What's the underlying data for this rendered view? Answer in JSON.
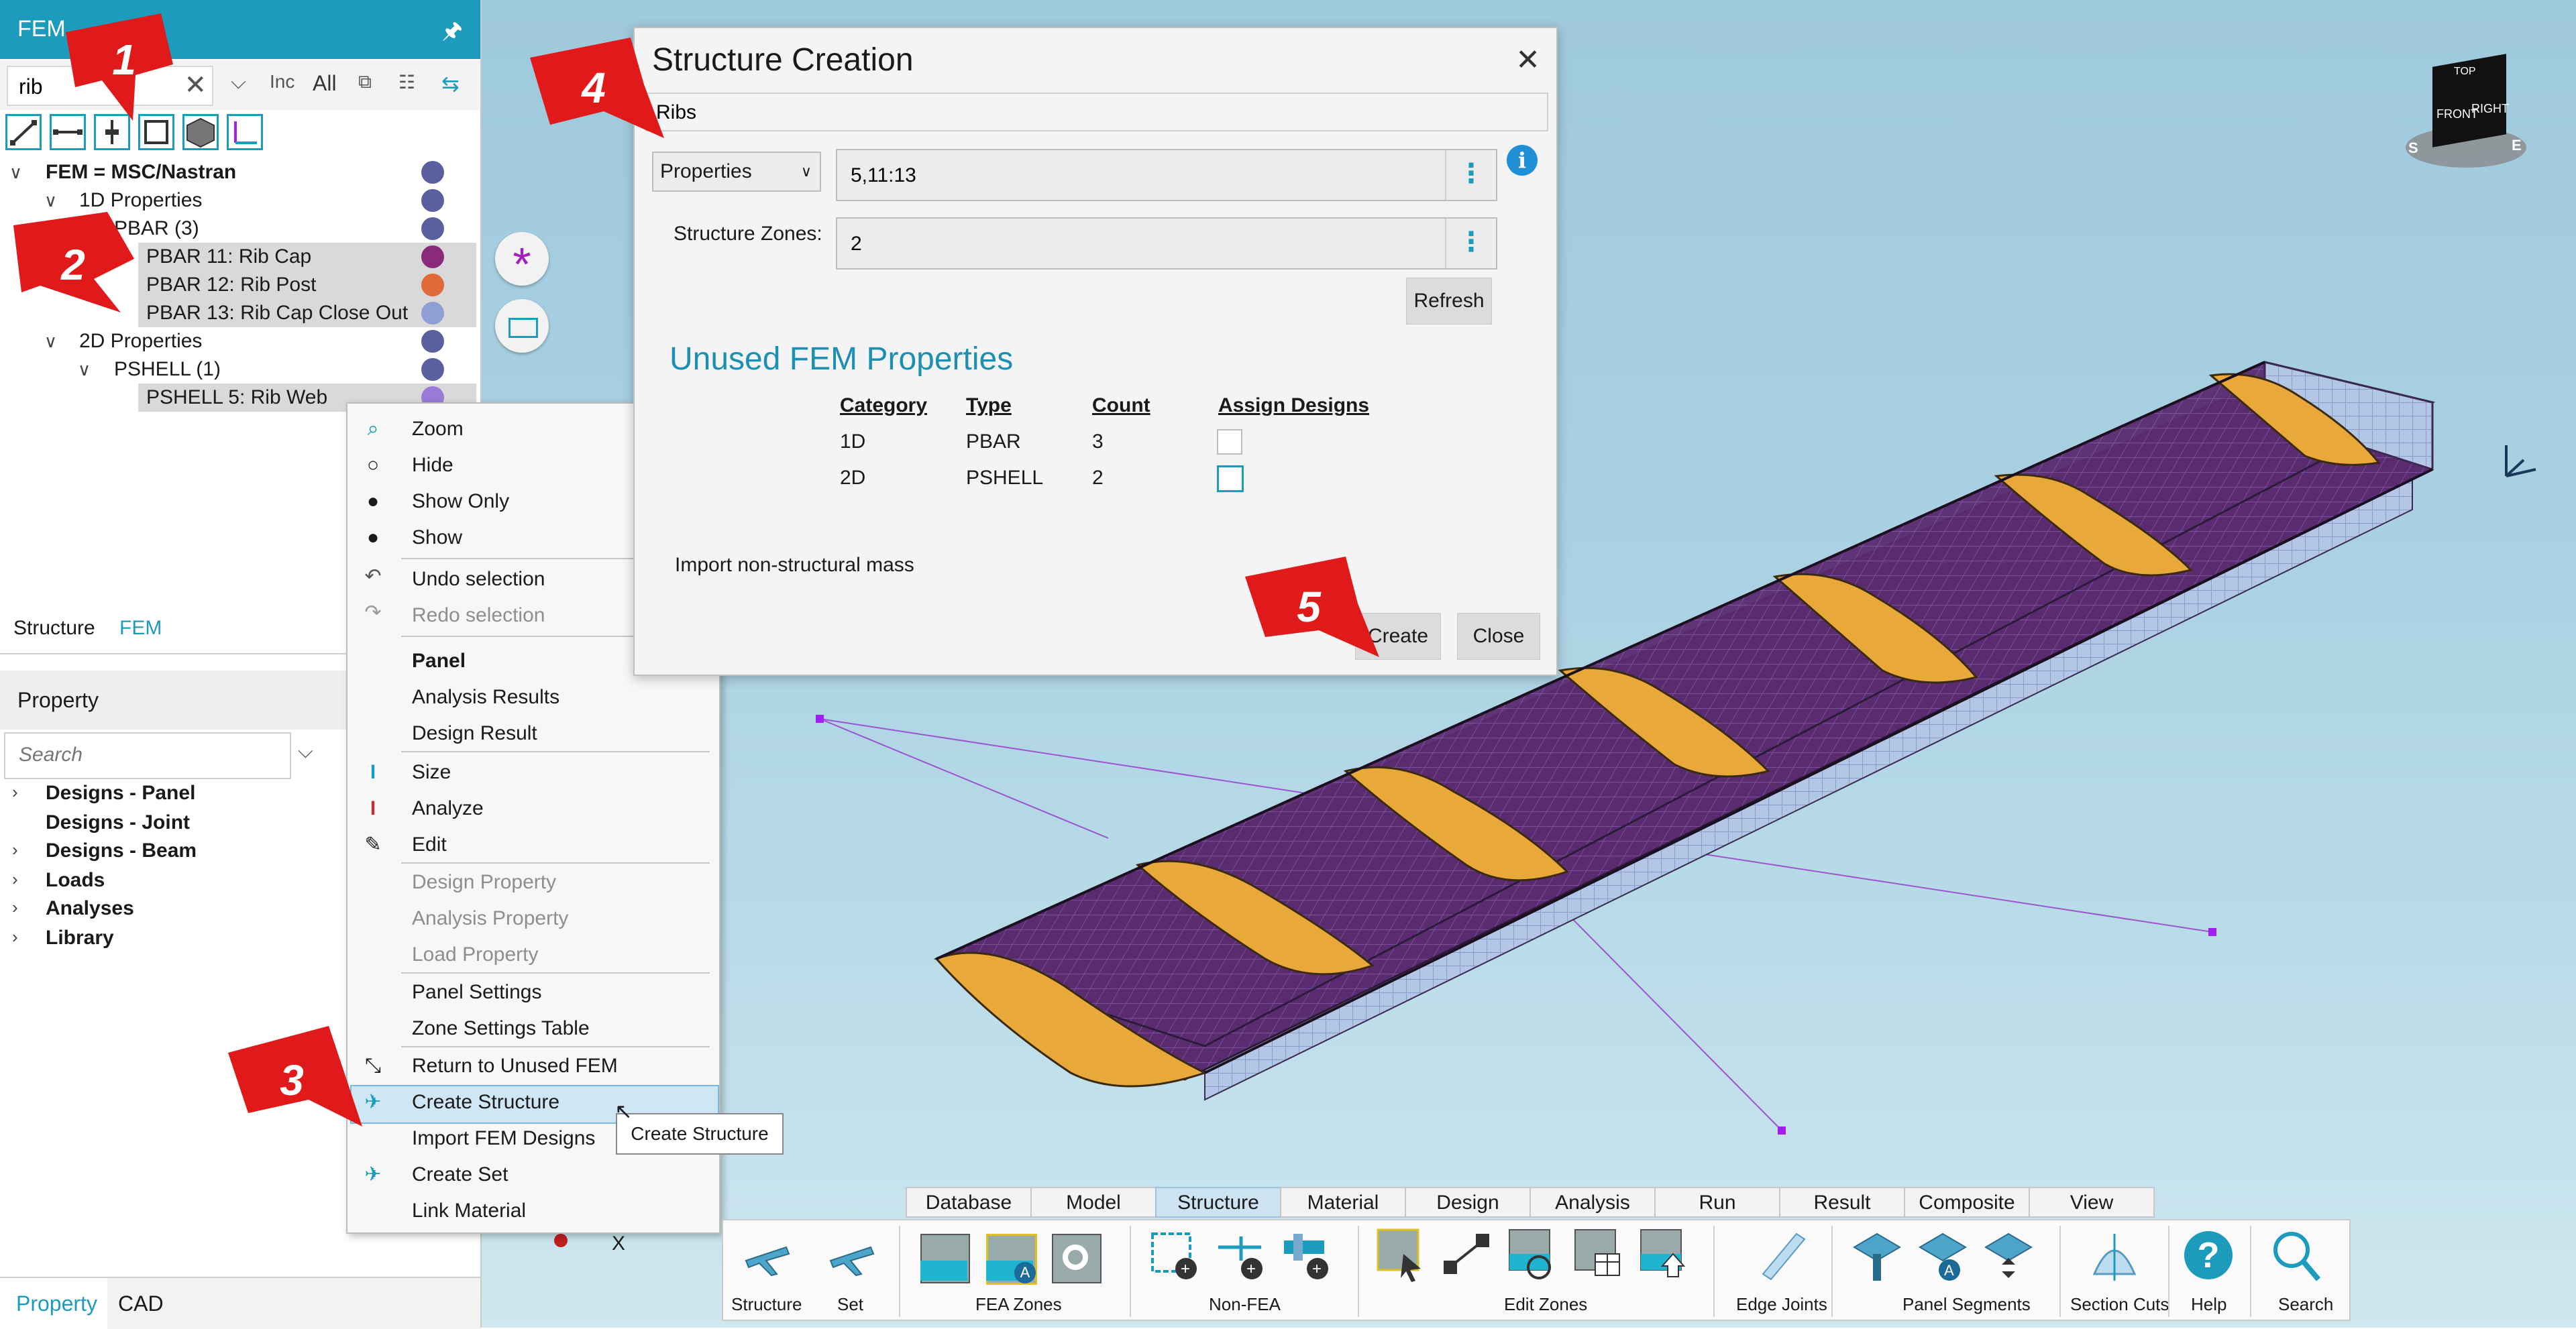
{
  "left_panel": {
    "header_title": "FEM",
    "search_value": "rib",
    "search_buttons": [
      "Inc",
      "All"
    ],
    "tree": [
      {
        "label": "FEM = MSC/Nastran",
        "bold": true
      },
      {
        "label": "1D Properties"
      },
      {
        "label": "PBAR (3)"
      },
      {
        "label": "PBAR 11: Rib Cap",
        "color": "#8a2a7a"
      },
      {
        "label": "PBAR 12: Rib Post",
        "color": "#e06a3a"
      },
      {
        "label": "PBAR 13: Rib Cap Close Out",
        "color": "#8f9fd6"
      },
      {
        "label": "2D Properties"
      },
      {
        "label": "PSHELL (1)"
      },
      {
        "label": "PSHELL 5: Rib Web",
        "color": "#9a7ad6"
      }
    ],
    "tabs": [
      "Structure",
      "FEM"
    ],
    "property_header": "Property",
    "property_search_placeholder": "Search",
    "property_tree": [
      "Designs - Panel",
      "Designs - Joint",
      "Designs - Beam",
      "Loads",
      "Analyses",
      "Library"
    ],
    "bottom_tabs": [
      "Property",
      "CAD"
    ]
  },
  "context_menu": {
    "items": [
      {
        "label": "Zoom",
        "icon": "zoom-icon"
      },
      {
        "label": "Hide",
        "icon": "hide-icon"
      },
      {
        "label": "Show Only",
        "icon": "show-only-icon"
      },
      {
        "label": "Show",
        "icon": "show-icon"
      },
      {
        "label": "Undo selection",
        "icon": "undo-icon"
      },
      {
        "label": "Redo selection",
        "icon": "redo-icon",
        "disabled": true
      },
      {
        "label": "Panel",
        "header": true
      },
      {
        "label": "Analysis Results"
      },
      {
        "label": "Design Result"
      },
      {
        "label": "Size",
        "icon": "size-icon"
      },
      {
        "label": "Analyze",
        "icon": "analyze-icon"
      },
      {
        "label": "Edit",
        "icon": "edit-icon"
      },
      {
        "label": "Design Property",
        "disabled": true
      },
      {
        "label": "Analysis Property",
        "disabled": true
      },
      {
        "label": "Load Property",
        "disabled": true
      },
      {
        "label": "Panel Settings"
      },
      {
        "label": "Zone Settings Table"
      },
      {
        "label": "Return to Unused FEM",
        "icon": "return-icon"
      },
      {
        "label": "Create Structure",
        "icon": "plane-icon",
        "highlighted": true
      },
      {
        "label": "Import FEM Designs"
      },
      {
        "label": "Create Set",
        "icon": "plane-icon"
      },
      {
        "label": "Link Material"
      }
    ],
    "tooltip": "Create Structure"
  },
  "dialog": {
    "title": "Structure Creation",
    "name_value": "Ribs",
    "selector": "Properties",
    "properties_value": "5,11:13",
    "zones_label": "Structure Zones:",
    "zones_value": "2",
    "refresh_label": "Refresh",
    "unused_title": "Unused FEM Properties",
    "table_headers": [
      "Category",
      "Type",
      "Count",
      "Assign Designs"
    ],
    "table_rows": [
      {
        "category": "1D",
        "type": "PBAR",
        "count": "3"
      },
      {
        "category": "2D",
        "type": "PSHELL",
        "count": "2"
      }
    ],
    "import_mass_label": "Import non-structural mass",
    "create_label": "Create",
    "close_label": "Close"
  },
  "ribbon": {
    "tabs": [
      "Database",
      "Model",
      "Structure",
      "Material",
      "Design",
      "Analysis",
      "Run",
      "Result",
      "Composite",
      "View"
    ],
    "active_tab": "Structure",
    "groups": [
      "Structure",
      "Set",
      "FEA Zones",
      "Non-FEA",
      "Edit Zones",
      "Edge Joints",
      "Panel Segments",
      "Section Cuts",
      "Help",
      "Search"
    ]
  },
  "viewcube": {
    "top": "TOP",
    "front": "FRONT",
    "right": "RIGHT",
    "compass_s": "S",
    "compass_e": "E"
  },
  "viewport": {
    "axis_label": "X"
  },
  "callouts": [
    "1",
    "2",
    "3",
    "4",
    "5"
  ],
  "colors": {
    "accent": "#1d9bbd",
    "callout": "#e01a1a",
    "skin": "#5a2a6e",
    "rib": "#e9a83a",
    "spar": "#b8c8e8"
  }
}
